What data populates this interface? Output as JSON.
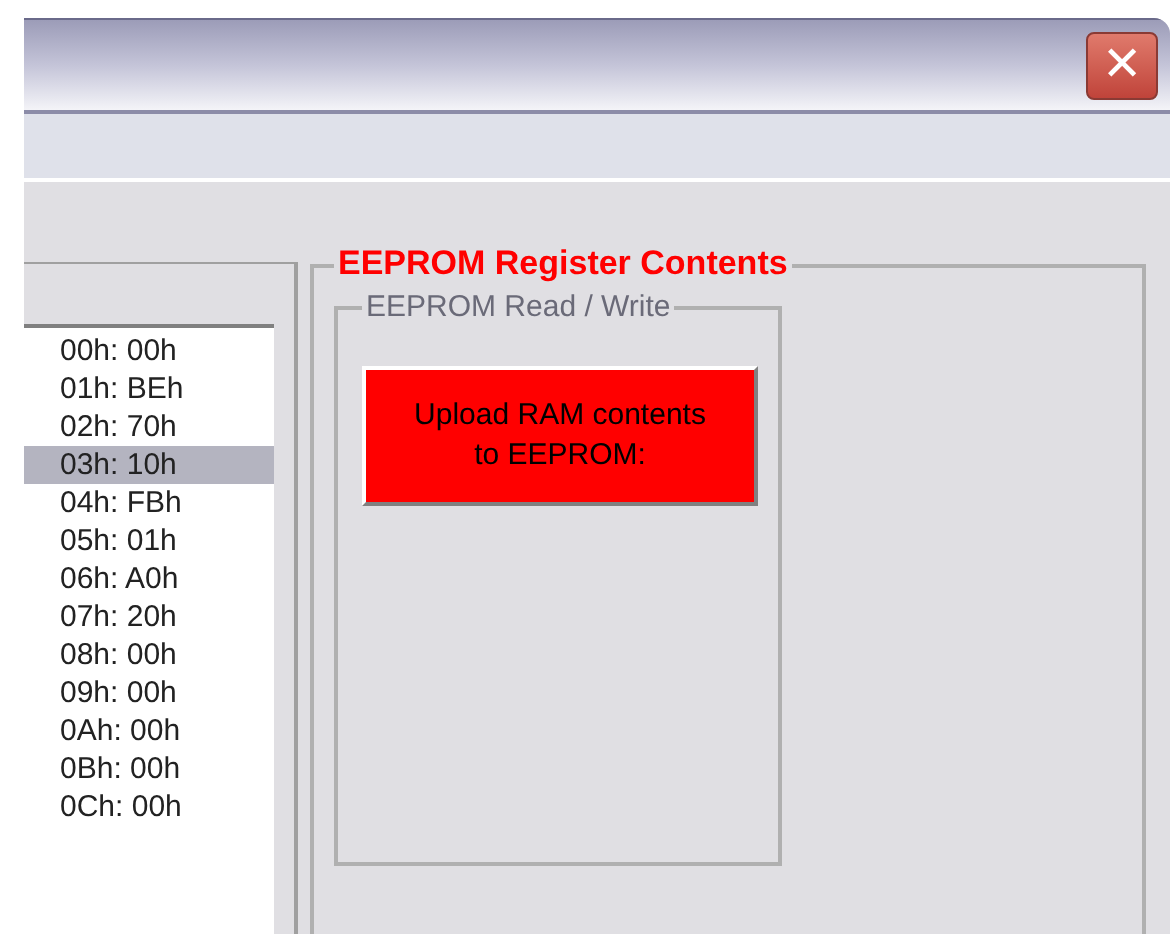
{
  "window": {
    "close_label": "✕"
  },
  "registers": [
    {
      "text": "00h: 00h",
      "selected": false
    },
    {
      "text": "01h: BEh",
      "selected": false
    },
    {
      "text": "02h: 70h",
      "selected": false
    },
    {
      "text": "03h: 10h",
      "selected": true
    },
    {
      "text": "04h: FBh",
      "selected": false
    },
    {
      "text": "05h: 01h",
      "selected": false
    },
    {
      "text": "06h: A0h",
      "selected": false
    },
    {
      "text": "07h: 20h",
      "selected": false
    },
    {
      "text": "08h: 00h",
      "selected": false
    },
    {
      "text": "09h: 00h",
      "selected": false
    },
    {
      "text": "0Ah: 00h",
      "selected": false
    },
    {
      "text": "0Bh: 00h",
      "selected": false
    },
    {
      "text": "0Ch: 00h",
      "selected": false
    }
  ],
  "register_group": {
    "title": "EEPROM Register Contents",
    "read_write_group": {
      "title": "EEPROM Read / Write",
      "upload_button": {
        "lines": [
          "Upload RAM contents",
          "to EEPROM:"
        ]
      }
    }
  }
}
